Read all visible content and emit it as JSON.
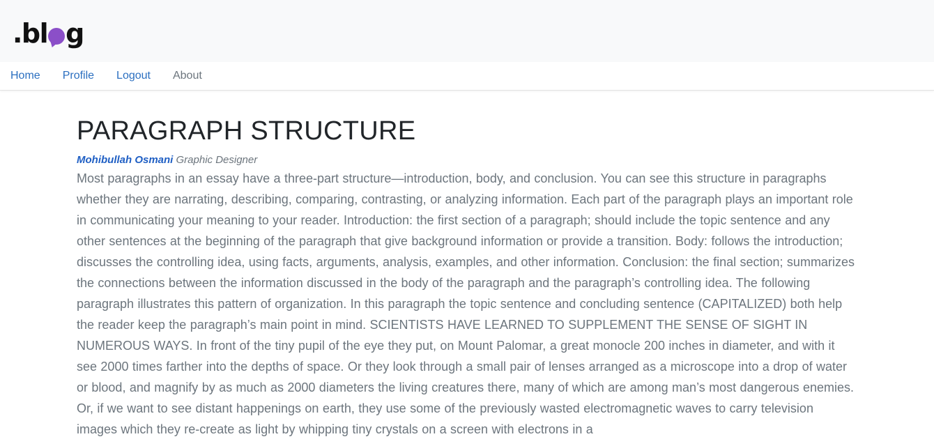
{
  "header": {
    "logo_text_left": ".bl",
    "logo_text_right": "g"
  },
  "nav": {
    "home": "Home",
    "profile": "Profile",
    "logout": "Logout",
    "about": "About"
  },
  "post": {
    "title": "PARAGRAPH STRUCTURE",
    "author": "Mohibullah Osmani",
    "role": "Graphic Designer",
    "body": "Most paragraphs in an essay have a three-part structure—introduction, body, and conclusion. You can see this structure in paragraphs whether they are narrating, describing, comparing, contrasting, or analyzing information. Each part of the paragraph plays an important role in communicating your meaning to your reader. Introduction: the first section of a paragraph; should include the topic sentence and any other sentences at the beginning of the paragraph that give background information or provide a transition. Body: follows the introduction; discusses the controlling idea, using facts, arguments, analysis, examples, and other information. Conclusion: the final section; summarizes the connections between the information discussed in the body of the paragraph and the paragraph’s controlling idea. The following paragraph illustrates this pattern of organization. In this paragraph the topic sentence and concluding sentence (CAPITALIZED) both help the reader keep the paragraph’s main point in mind. SCIENTISTS HAVE LEARNED TO SUPPLEMENT THE SENSE OF SIGHT IN NUMEROUS WAYS. In front of the tiny pupil of the eye they put, on Mount Palomar, a great monocle 200 inches in diameter, and with it see 2000 times farther into the depths of space. Or they look through a small pair of lenses arranged as a microscope into a drop of water or blood, and magnify by as much as 2000 diameters the living creatures there, many of which are among man’s most dangerous enemies. Or, if we want to see distant happenings on earth, they use some of the previously wasted electromagnetic waves to carry television images which they re-create as light by whipping tiny crystals on a screen with electrons in a"
  },
  "colors": {
    "brand_accent": "#8b4fc8",
    "link": "#2b6fc0",
    "muted": "#6c757d",
    "author": "#1f5fc4"
  }
}
